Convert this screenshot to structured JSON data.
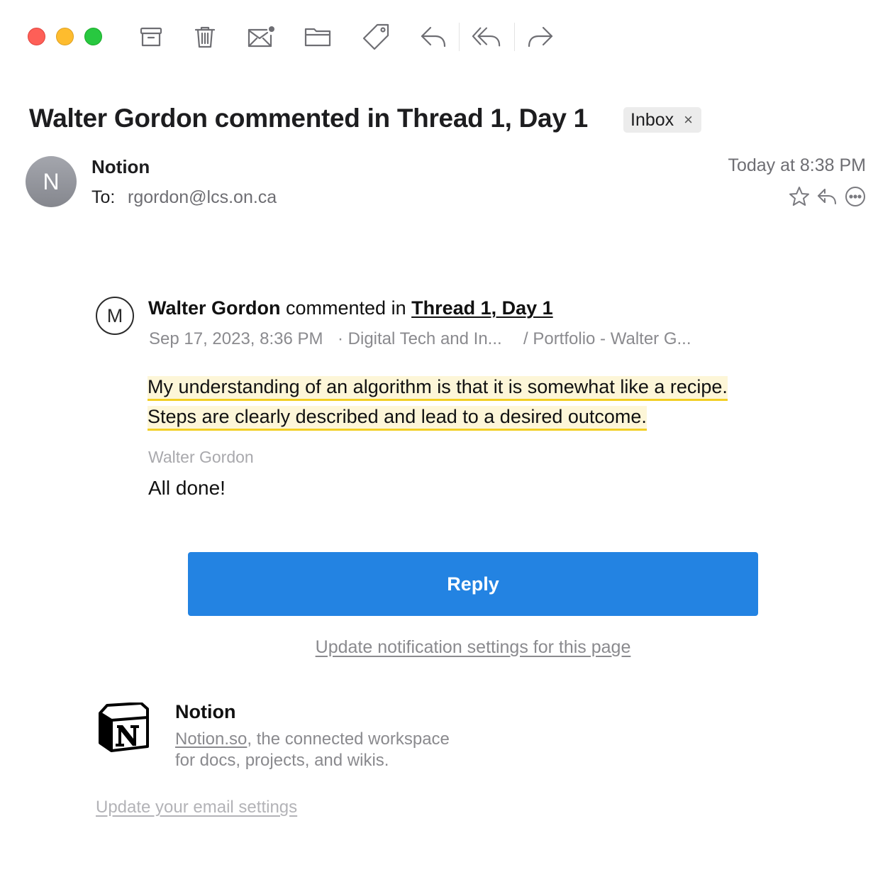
{
  "toolbar": {
    "buttons": [
      {
        "name": "archive",
        "icon": "archive-icon"
      },
      {
        "name": "trash",
        "icon": "trash-icon"
      },
      {
        "name": "junk",
        "icon": "junk-mail-icon"
      },
      {
        "name": "move",
        "icon": "folder-icon"
      },
      {
        "name": "tag",
        "icon": "tag-icon"
      },
      {
        "name": "reply",
        "icon": "reply-icon"
      },
      {
        "name": "reply-all",
        "icon": "reply-all-icon"
      },
      {
        "name": "forward",
        "icon": "forward-icon"
      }
    ]
  },
  "message": {
    "subject": "Walter Gordon commented in Thread 1, Day 1",
    "mailbox_tag": "Inbox",
    "mailbox_tag_close": "×",
    "sender_initial": "N",
    "sender": "Notion",
    "to_label": "To:",
    "to_address": "rgordon@lcs.on.ca",
    "date": "Today at 8:38 PM"
  },
  "notion": {
    "commenter_initial": "M",
    "commenter": "Walter Gordon",
    "action": " commented in ",
    "page": "Thread 1, Day 1",
    "timestamp": "Sep 17, 2023, 8:36 PM",
    "breadcrumb_1": "· Digital Tech and In...",
    "breadcrumb_2": "/ Portfolio - Walter G...",
    "quote_line_1": "My understanding of an algorithm is that it is somewhat like a recipe.",
    "quote_line_2": "Steps are clearly described and lead to a desired outcome.",
    "comment_author": "Walter Gordon",
    "comment_text": "All done!",
    "reply_button": "Reply",
    "notification_link": "Update notification settings for this page",
    "footer_title": "Notion",
    "footer_link": "Notion.so",
    "footer_desc_1": ", the connected workspace",
    "footer_desc_2": "for docs, projects, and wikis.",
    "email_settings_link": "Update your email settings"
  },
  "colors": {
    "accent": "#2383e2",
    "highlight_bg": "#fdf6d8",
    "highlight_underline": "#f2cf25"
  }
}
